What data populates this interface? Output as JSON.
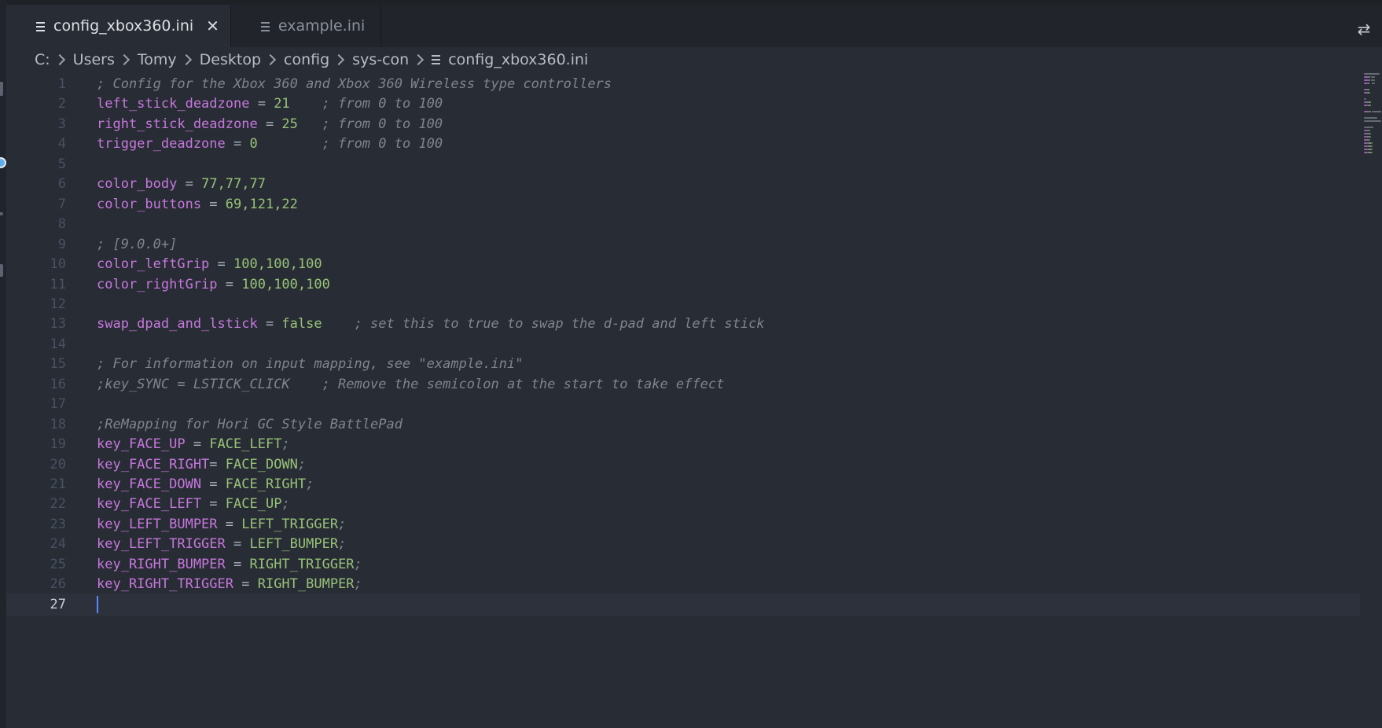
{
  "tabs": [
    {
      "label": "config_xbox360.ini",
      "active": true,
      "close": "✕"
    },
    {
      "label": "example.ini",
      "active": false
    }
  ],
  "breadcrumb": [
    "C:",
    "Users",
    "Tomy",
    "Desktop",
    "config",
    "sys-con",
    "config_xbox360.ini"
  ],
  "icons": {
    "file": "file-lines-icon",
    "compare": "compare-changes-icon",
    "chevron": "chevron-right-icon"
  },
  "colors": {
    "key": "#c678dd",
    "value": "#98c379",
    "comment": "#7f848e",
    "background": "#282c34"
  },
  "current_line": 27,
  "lines": [
    [
      [
        "c",
        "; Config for the Xbox 360 and Xbox 360 Wireless type controllers"
      ]
    ],
    [
      [
        "k",
        "left_stick_deadzone"
      ],
      [
        "o",
        " = "
      ],
      [
        "v",
        "21"
      ],
      [
        "o",
        "    "
      ],
      [
        "c",
        "; from 0 to 100"
      ]
    ],
    [
      [
        "k",
        "right_stick_deadzone"
      ],
      [
        "o",
        " = "
      ],
      [
        "v",
        "25"
      ],
      [
        "o",
        "   "
      ],
      [
        "c",
        "; from 0 to 100"
      ]
    ],
    [
      [
        "k",
        "trigger_deadzone"
      ],
      [
        "o",
        " = "
      ],
      [
        "v",
        "0"
      ],
      [
        "o",
        "        "
      ],
      [
        "c",
        "; from 0 to 100"
      ]
    ],
    [],
    [
      [
        "k",
        "color_body"
      ],
      [
        "o",
        " = "
      ],
      [
        "v",
        "77,77,77"
      ]
    ],
    [
      [
        "k",
        "color_buttons"
      ],
      [
        "o",
        " = "
      ],
      [
        "v",
        "69,121,22"
      ]
    ],
    [],
    [
      [
        "c",
        "; [9.0.0+]"
      ]
    ],
    [
      [
        "k",
        "color_leftGrip"
      ],
      [
        "o",
        " = "
      ],
      [
        "v",
        "100,100,100"
      ]
    ],
    [
      [
        "k",
        "color_rightGrip"
      ],
      [
        "o",
        " = "
      ],
      [
        "v",
        "100,100,100"
      ]
    ],
    [],
    [
      [
        "k",
        "swap_dpad_and_lstick"
      ],
      [
        "o",
        " = "
      ],
      [
        "v",
        "false"
      ],
      [
        "o",
        "    "
      ],
      [
        "c",
        "; set this to true to swap the d-pad and left stick"
      ]
    ],
    [],
    [
      [
        "c",
        "; For information on input mapping, see \"example.ini\""
      ]
    ],
    [
      [
        "c",
        ";key_SYNC = LSTICK_CLICK    ; Remove the semicolon at the start to take effect"
      ]
    ],
    [],
    [
      [
        "c",
        ";ReMapping for Hori GC Style BattlePad"
      ]
    ],
    [
      [
        "k",
        "key_FACE_UP"
      ],
      [
        "o",
        " = "
      ],
      [
        "v",
        "FACE_LEFT"
      ],
      [
        "c",
        ";"
      ]
    ],
    [
      [
        "k",
        "key_FACE_RIGHT"
      ],
      [
        "o",
        "= "
      ],
      [
        "v",
        "FACE_DOWN"
      ],
      [
        "c",
        ";"
      ]
    ],
    [
      [
        "k",
        "key_FACE_DOWN"
      ],
      [
        "o",
        " = "
      ],
      [
        "v",
        "FACE_RIGHT"
      ],
      [
        "c",
        ";"
      ]
    ],
    [
      [
        "k",
        "key_FACE_LEFT"
      ],
      [
        "o",
        " = "
      ],
      [
        "v",
        "FACE_UP"
      ],
      [
        "c",
        ";"
      ]
    ],
    [
      [
        "k",
        "key_LEFT_BUMPER"
      ],
      [
        "o",
        " = "
      ],
      [
        "v",
        "LEFT_TRIGGER"
      ],
      [
        "c",
        ";"
      ]
    ],
    [
      [
        "k",
        "key_LEFT_TRIGGER"
      ],
      [
        "o",
        " = "
      ],
      [
        "v",
        "LEFT_BUMPER"
      ],
      [
        "c",
        ";"
      ]
    ],
    [
      [
        "k",
        "key_RIGHT_BUMPER"
      ],
      [
        "o",
        " = "
      ],
      [
        "v",
        "RIGHT_TRIGGER"
      ],
      [
        "c",
        ";"
      ]
    ],
    [
      [
        "k",
        "key_RIGHT_TRIGGER"
      ],
      [
        "o",
        " = "
      ],
      [
        "v",
        "RIGHT_BUMPER"
      ],
      [
        "c",
        ";"
      ]
    ],
    []
  ]
}
